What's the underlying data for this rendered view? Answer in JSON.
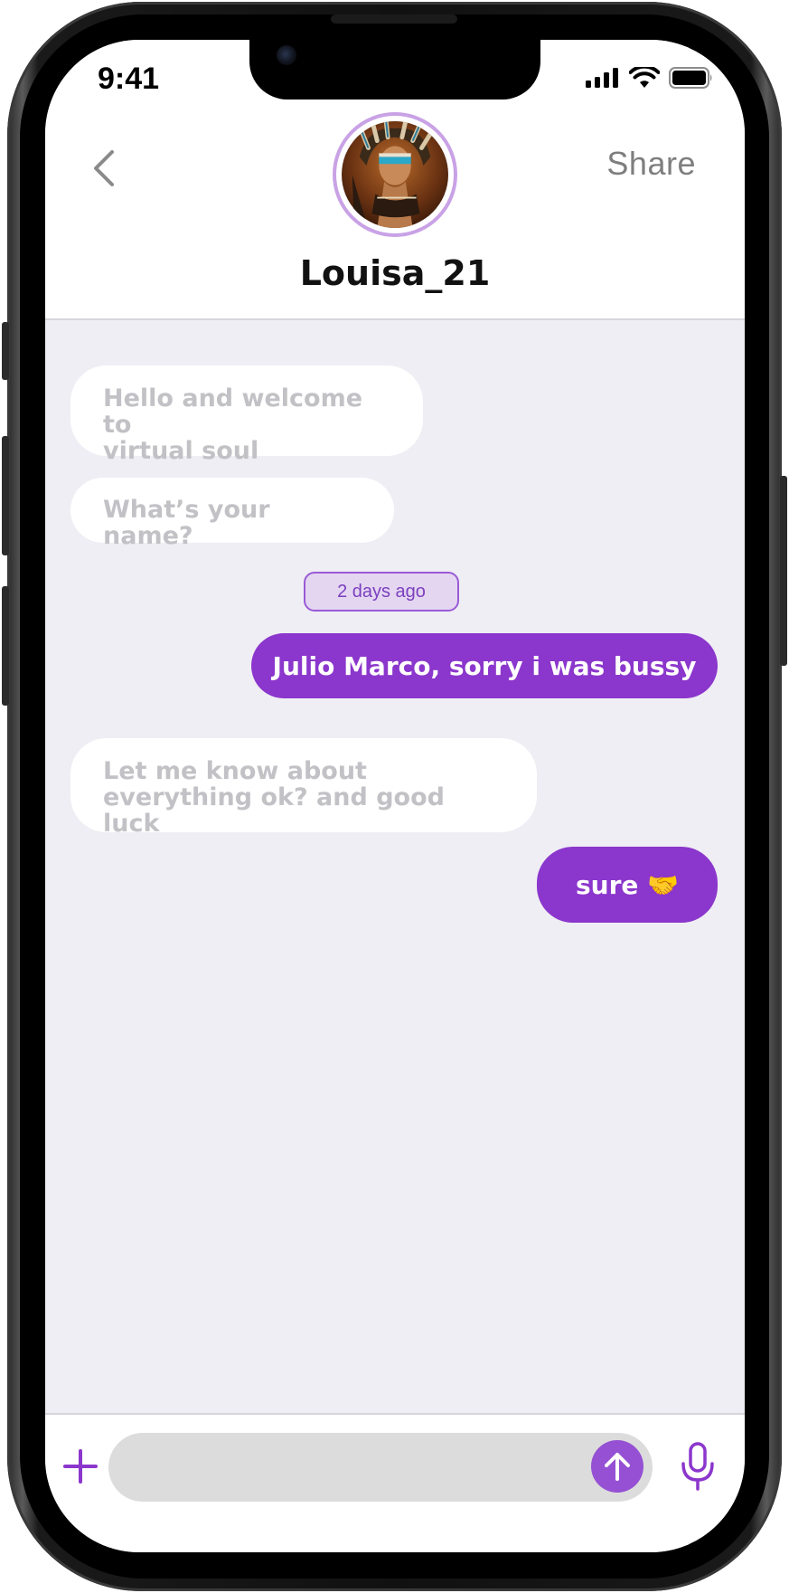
{
  "status_bar": {
    "time": "9:41"
  },
  "header": {
    "back_icon": "chevron-left-icon",
    "share_label": "Share",
    "username": "Louisa_21"
  },
  "messages": [
    {
      "direction": "incoming",
      "text": "Hello and welcome to\nvirtual soul"
    },
    {
      "direction": "incoming",
      "text": "What’s your name?"
    },
    {
      "direction": "outgoing",
      "text": "Julio Marco, sorry i was bussy"
    },
    {
      "direction": "incoming",
      "text": "Let me know about\neverything ok? and good luck"
    },
    {
      "direction": "outgoing",
      "text": "sure 🤝"
    }
  ],
  "timestamp": "2 days ago",
  "composer": {
    "value": "",
    "placeholder": "",
    "plus_icon": "plus-icon",
    "send_icon": "arrow-up-icon",
    "mic_icon": "microphone-icon"
  },
  "colors": {
    "accent": "#8b36cc",
    "chat_background": "#efeef4",
    "incoming_text": "#c2c2c6",
    "avatar_ring": "#c9a2e6"
  }
}
